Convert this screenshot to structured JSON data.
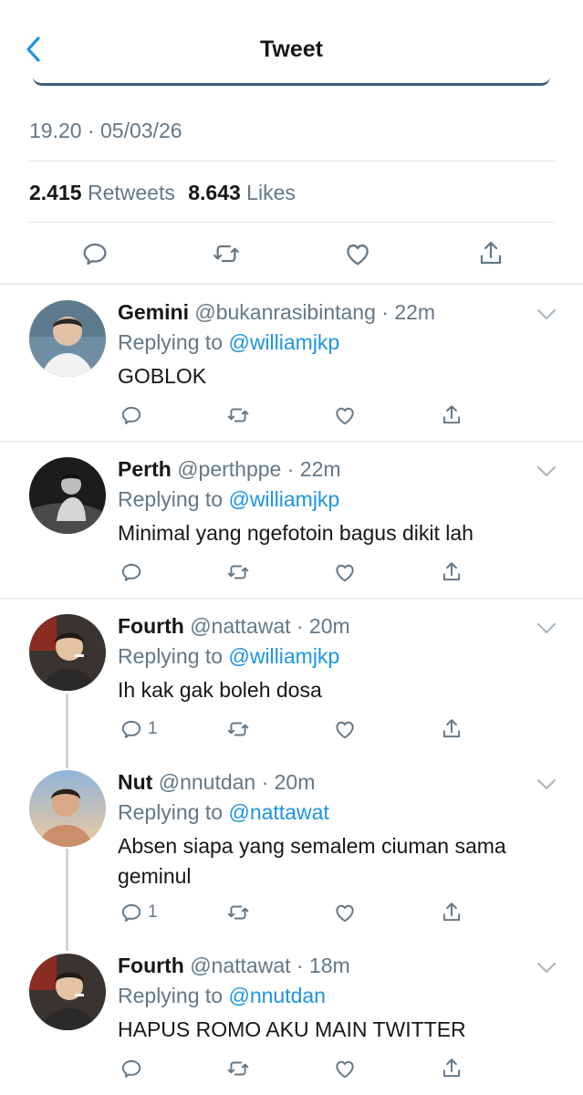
{
  "header": {
    "title": "Tweet"
  },
  "tweet": {
    "timestamp": "19.20 · 05/03/26",
    "retweets_count": "2.415",
    "retweets_label": "Retweets",
    "likes_count": "8.643",
    "likes_label": "Likes"
  },
  "replies": [
    {
      "name": "Gemini",
      "handle": "@bukanrasibintang · 22m",
      "replying_label": "Replying to",
      "replying_to": "@williamjkp",
      "text": "GOBLOK",
      "reply_count": ""
    },
    {
      "name": "Perth",
      "handle": "@perthppe · 22m",
      "replying_label": "Replying to",
      "replying_to": "@williamjkp",
      "text": "Minimal yang ngefotoin bagus dikit lah",
      "reply_count": ""
    },
    {
      "name": "Fourth",
      "handle": "@nattawat · 20m",
      "replying_label": "Replying to",
      "replying_to": "@williamjkp",
      "text": "Ih kak gak boleh dosa",
      "reply_count": "1"
    },
    {
      "name": "Nut",
      "handle": "@nnutdan · 20m",
      "replying_label": "Replying to",
      "replying_to": "@nattawat",
      "text": "Absen siapa yang semalem ciuman sama geminul",
      "reply_count": "1"
    },
    {
      "name": "Fourth",
      "handle": "@nattawat · 18m",
      "replying_label": "Replying to",
      "replying_to": "@nnutdan",
      "text": "HAPUS ROMO AKU MAIN TWITTER",
      "reply_count": ""
    }
  ],
  "colors": {
    "accent": "#1b95e0",
    "secondary_text": "#657786",
    "primary_text": "#14171a"
  }
}
